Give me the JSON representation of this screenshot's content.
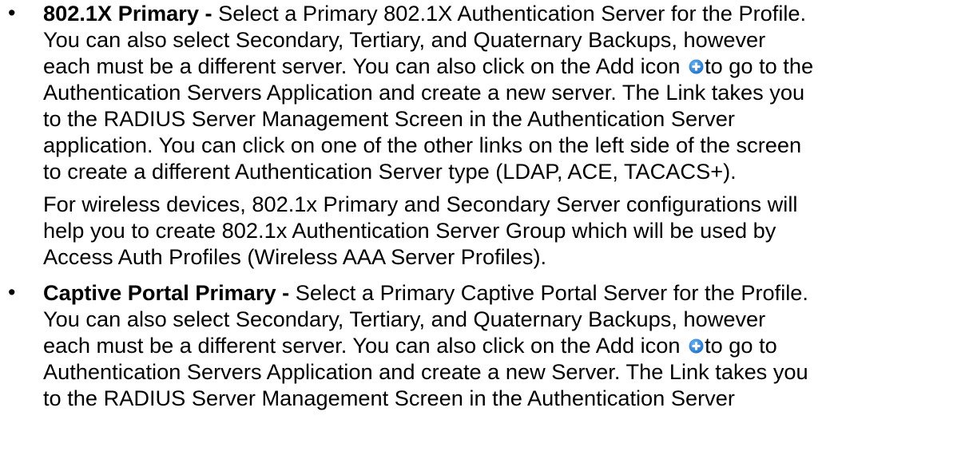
{
  "items": [
    {
      "bullet": "•",
      "lines": [
        {
          "bold": "802.1X Primary -",
          "text": " Select a Primary 802.1X Authentication Server for the Profile."
        },
        {
          "text": "You can also select Secondary, Tertiary, and Quaternary Backups, however"
        },
        {
          "before": "each must be a different server. You can also click on the Add icon ",
          "after": "to go to the"
        },
        {
          "text": "Authentication Servers Application and create a new server. The Link takes you"
        },
        {
          "text": "to the RADIUS Server Management Screen in the Authentication Server"
        },
        {
          "text": "application. You can click on one of the other links on the left side of the screen"
        },
        {
          "text": "to create a different Authentication Server type (LDAP, ACE, TACACS+)."
        }
      ],
      "extra_lines": [
        "For wireless devices, 802.1x Primary and Secondary Server configurations will",
        "help you to create 802.1x Authentication Server Group which will be used by",
        "Access Auth Profiles (Wireless AAA Server Profiles)."
      ]
    },
    {
      "bullet": "•",
      "lines": [
        {
          "bold": "Captive Portal Primary -",
          "text": " Select a Primary Captive Portal Server for the Profile."
        },
        {
          "text": "You can also select Secondary, Tertiary, and Quaternary Backups, however"
        },
        {
          "before": "each must be a different server. You can also click on the Add icon ",
          "after": "to go to"
        },
        {
          "text": "Authentication Servers Application and create a new Server. The Link takes you"
        },
        {
          "text": "to the RADIUS Server Management Screen in the Authentication Server"
        }
      ]
    }
  ],
  "icons": {
    "add_icon": "add-circle-icon",
    "add_icon_color": "#2f84d8"
  }
}
